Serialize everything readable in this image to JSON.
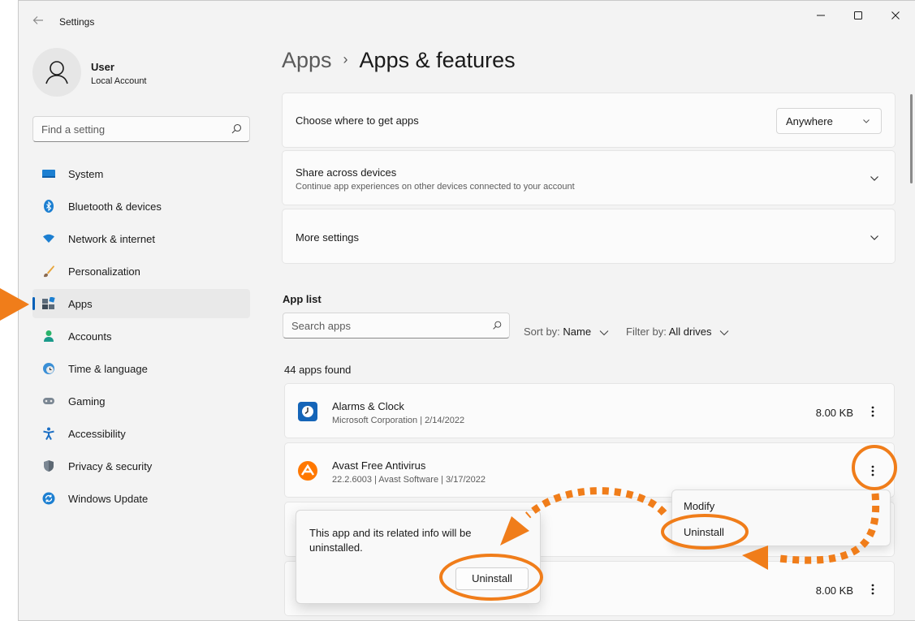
{
  "window": {
    "title": "Settings"
  },
  "user": {
    "name": "User",
    "account": "Local Account"
  },
  "find_setting": {
    "placeholder": "Find a setting"
  },
  "nav": [
    {
      "label": "System",
      "icon": "monitor-icon"
    },
    {
      "label": "Bluetooth & devices",
      "icon": "bluetooth-icon"
    },
    {
      "label": "Network & internet",
      "icon": "wifi-icon"
    },
    {
      "label": "Personalization",
      "icon": "brush-icon"
    },
    {
      "label": "Apps",
      "icon": "apps-icon",
      "active": true
    },
    {
      "label": "Accounts",
      "icon": "person-icon"
    },
    {
      "label": "Time & language",
      "icon": "globe-clock-icon"
    },
    {
      "label": "Gaming",
      "icon": "gamepad-icon"
    },
    {
      "label": "Accessibility",
      "icon": "accessibility-icon"
    },
    {
      "label": "Privacy & security",
      "icon": "shield-icon"
    },
    {
      "label": "Windows Update",
      "icon": "update-icon"
    }
  ],
  "breadcrumb": {
    "parent": "Apps",
    "separator": "›",
    "current": "Apps & features"
  },
  "settings": {
    "choose": {
      "title": "Choose where to get apps",
      "value": "Anywhere"
    },
    "share": {
      "title": "Share across devices",
      "subtitle": "Continue app experiences on other devices connected to your account"
    },
    "more": {
      "title": "More settings"
    }
  },
  "app_list": {
    "title": "App list",
    "search_placeholder": "Search apps",
    "sort_label": "Sort by:",
    "sort_value": "Name",
    "filter_label": "Filter by:",
    "filter_value": "All drives",
    "count": "44 apps found",
    "apps": [
      {
        "name": "Alarms & Clock",
        "meta": "Microsoft Corporation   |   2/14/2022",
        "size": "8.00 KB",
        "icon": "alarm-clock-icon"
      },
      {
        "name": "Avast Free Antivirus",
        "meta": "22.2.6003   |   Avast Software   |   3/17/2022",
        "size": "",
        "icon": "avast-icon"
      },
      {
        "name": "",
        "meta": "",
        "size": "",
        "icon": ""
      },
      {
        "name": "",
        "meta": "",
        "size": "8.00 KB",
        "icon": ""
      }
    ]
  },
  "context_menu": {
    "modify": "Modify",
    "uninstall": "Uninstall"
  },
  "confirm": {
    "message": "This app and its related info will be uninstalled.",
    "button": "Uninstall"
  },
  "colors": {
    "accent": "#005fb8",
    "annotation": "#f07d1a",
    "avast_orange": "#ff7800"
  }
}
